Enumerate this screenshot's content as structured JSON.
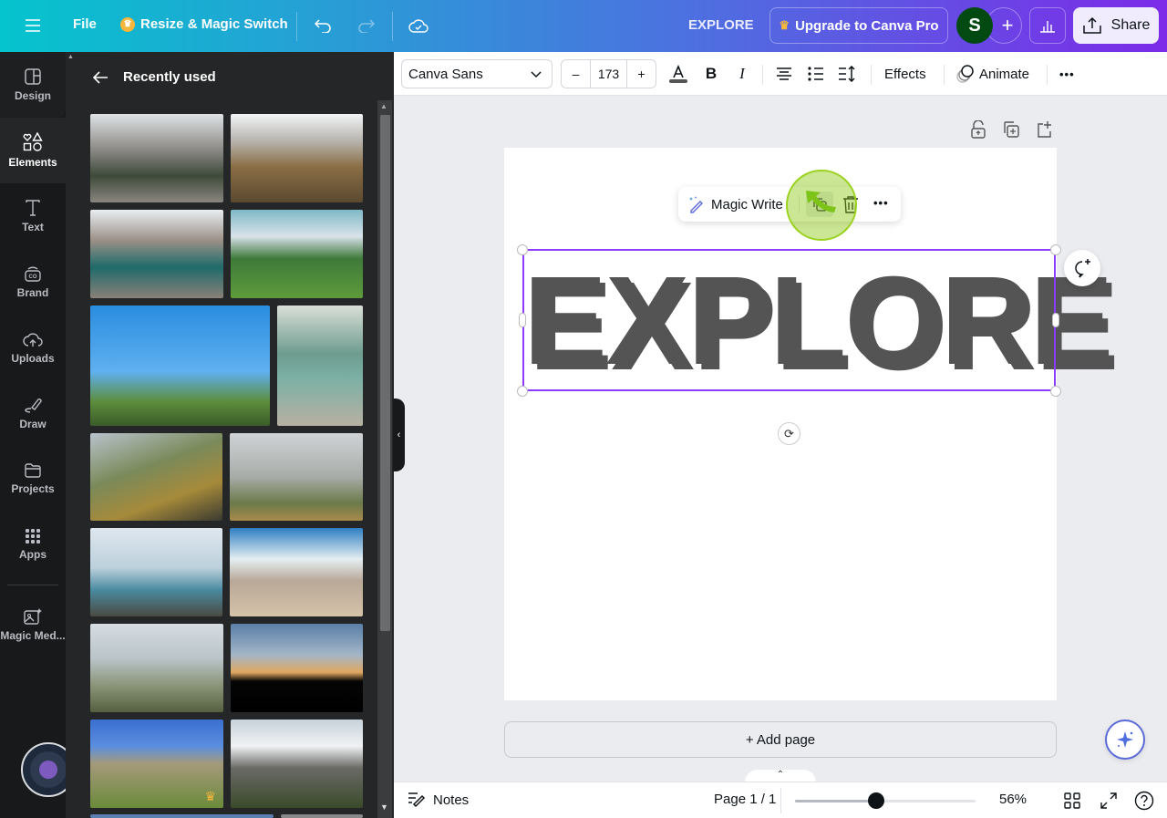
{
  "header": {
    "menu_icon": "hamburger-icon",
    "file_label": "File",
    "resize_label": "Resize & Magic Switch",
    "undo_icon": "undo-icon",
    "redo_icon": "redo-icon",
    "cloud_icon": "cloud-check-icon",
    "doc_title": "EXPLORE",
    "upgrade_label": "Upgrade to Canva Pro",
    "avatar_initial": "S",
    "plus_label": "+",
    "share_label": "Share",
    "colors": {
      "avatar_bg": "#024a12",
      "crown": "#f5b73b"
    }
  },
  "rail": {
    "items": [
      {
        "label": "Design",
        "icon": "design-layout-icon"
      },
      {
        "label": "Elements",
        "icon": "shapes-icon",
        "active": true
      },
      {
        "label": "Text",
        "icon": "text-t-icon"
      },
      {
        "label": "Brand",
        "icon": "brand-icon"
      },
      {
        "label": "Uploads",
        "icon": "cloud-upload-icon"
      },
      {
        "label": "Draw",
        "icon": "draw-pen-icon"
      },
      {
        "label": "Projects",
        "icon": "folder-icon"
      },
      {
        "label": "Apps",
        "icon": "apps-grid-icon"
      },
      {
        "label": "Magic Med...",
        "icon": "magic-media-icon"
      }
    ]
  },
  "panel": {
    "title": "Recently used",
    "images": [
      {
        "desc": "Hiker in yellow jacket facing rocky mountain valley"
      },
      {
        "desc": "Hiker with poles overlooking snowy mountains"
      },
      {
        "desc": "People sitting by turquoise mountain lake"
      },
      {
        "desc": "Person with open arms before volcano and green hills"
      },
      {
        "desc": "Hiker with orange backpack on rock under blue sky"
      },
      {
        "desc": "Couple sitting above river canyon"
      },
      {
        "desc": "Couple sitting on wall overlooking green mountains"
      },
      {
        "desc": "Hiker in purple jacket facing misty valley"
      },
      {
        "desc": "Person with binoculars above sea of clouds"
      },
      {
        "desc": "Woman walking on dirt road toward snowy peaks"
      },
      {
        "desc": "Person on cliff top above clouds"
      },
      {
        "desc": "Silhouettes of hikers at sunset"
      },
      {
        "desc": "Group of hikers on rocky trail",
        "premium": true
      },
      {
        "desc": "Hiker with yellow backpack in snowy valley"
      }
    ]
  },
  "toolbar": {
    "font": "Canva Sans",
    "font_size": "173",
    "minus": "–",
    "plus": "+",
    "bold": "B",
    "italic": "I",
    "effects": "Effects",
    "animate": "Animate",
    "more": "•••",
    "text_color": "#545454"
  },
  "canvas": {
    "text": "EXPLORE",
    "magic_write": "Magic Write",
    "more": "•••",
    "add_page": "+ Add page",
    "selection_color": "#8b3dff"
  },
  "footer": {
    "notes": "Notes",
    "page_indicator": "Page 1 / 1",
    "zoom": "56%",
    "zoom_fraction": 0.45
  }
}
